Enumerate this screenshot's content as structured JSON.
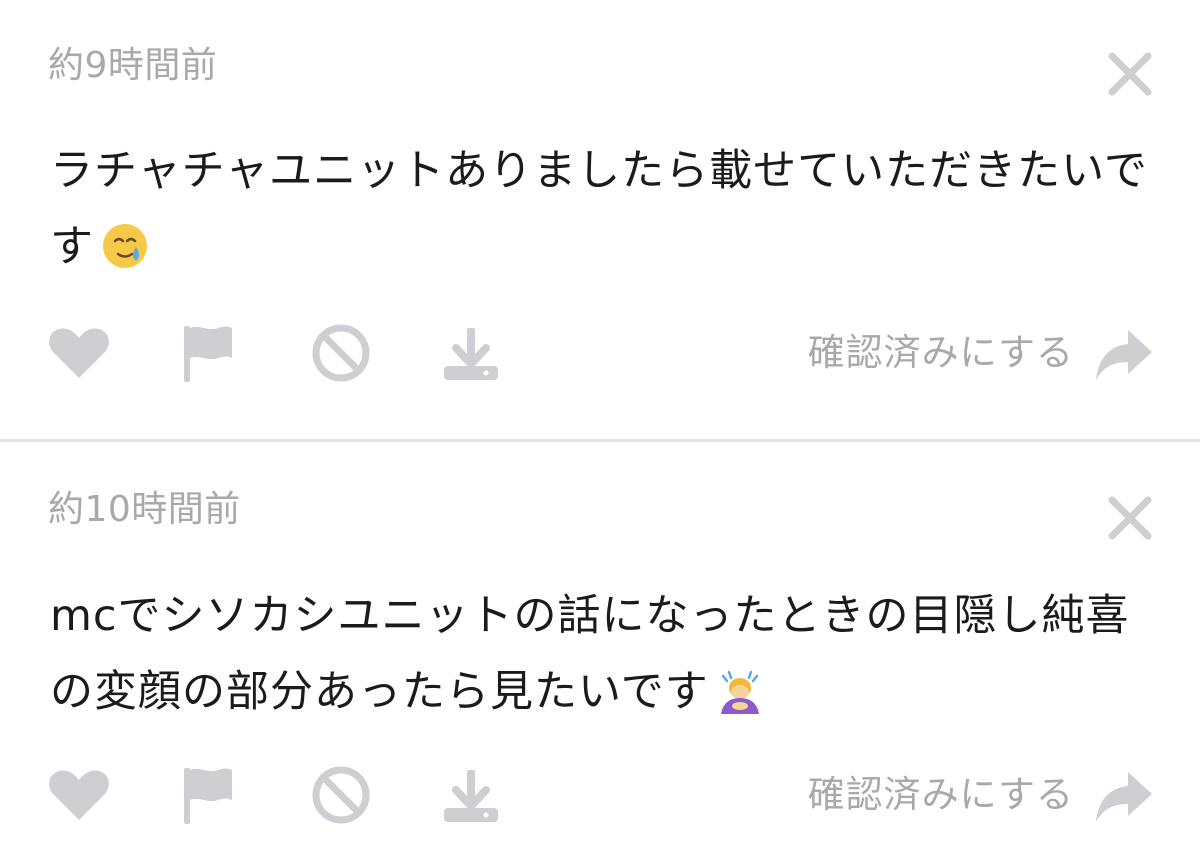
{
  "posts": [
    {
      "timestamp": "約9時間前",
      "message": "ラチャチャユニットありましたら載せていただきたいです",
      "emoji": "face-holding-back-tears",
      "confirm_label": "確認済みにする"
    },
    {
      "timestamp": "約10時間前",
      "message": "mcでシソカシユニットの話になったときの目隠し純喜の変顔の部分あったら見たいです",
      "emoji": "person-bowing",
      "confirm_label": "確認済みにする"
    }
  ],
  "colors": {
    "icon_gray": "#cfcfd3",
    "text_gray": "#a8a8ad",
    "text_main": "#1b1b1b",
    "divider": "#e3e3e6"
  }
}
